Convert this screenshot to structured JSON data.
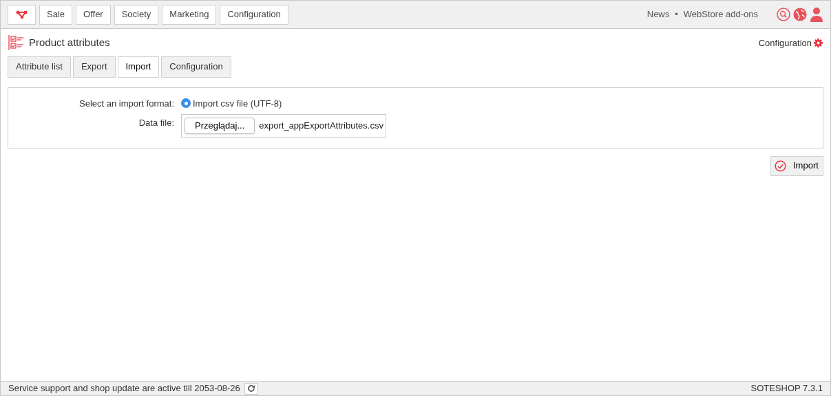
{
  "top_nav": {
    "menu": [
      {
        "label": "Sale"
      },
      {
        "label": "Offer"
      },
      {
        "label": "Society"
      },
      {
        "label": "Marketing"
      },
      {
        "label": "Configuration"
      }
    ],
    "links": [
      {
        "label": "News"
      },
      {
        "label": "WebStore add-ons"
      }
    ],
    "separator": "•"
  },
  "page": {
    "title": "Product attributes",
    "config_link": "Configuration"
  },
  "tabs": [
    {
      "label": "Attribute list",
      "selected": false
    },
    {
      "label": "Export",
      "selected": false
    },
    {
      "label": "Import",
      "selected": true
    },
    {
      "label": "Configuration",
      "selected": false
    }
  ],
  "form": {
    "format_label": "Select an import format:",
    "format_option": {
      "label": "Import csv file (UTF-8)",
      "selected": true
    },
    "file_label": "Data file:",
    "browse_button": "Przeglądaj...",
    "file_name": "export_appExportAttributes.csv"
  },
  "import_button": "Import",
  "status_bar": {
    "message": "Service support and shop update are active till 2053-08-26",
    "version": "SOTESHOP 7.3.1"
  }
}
